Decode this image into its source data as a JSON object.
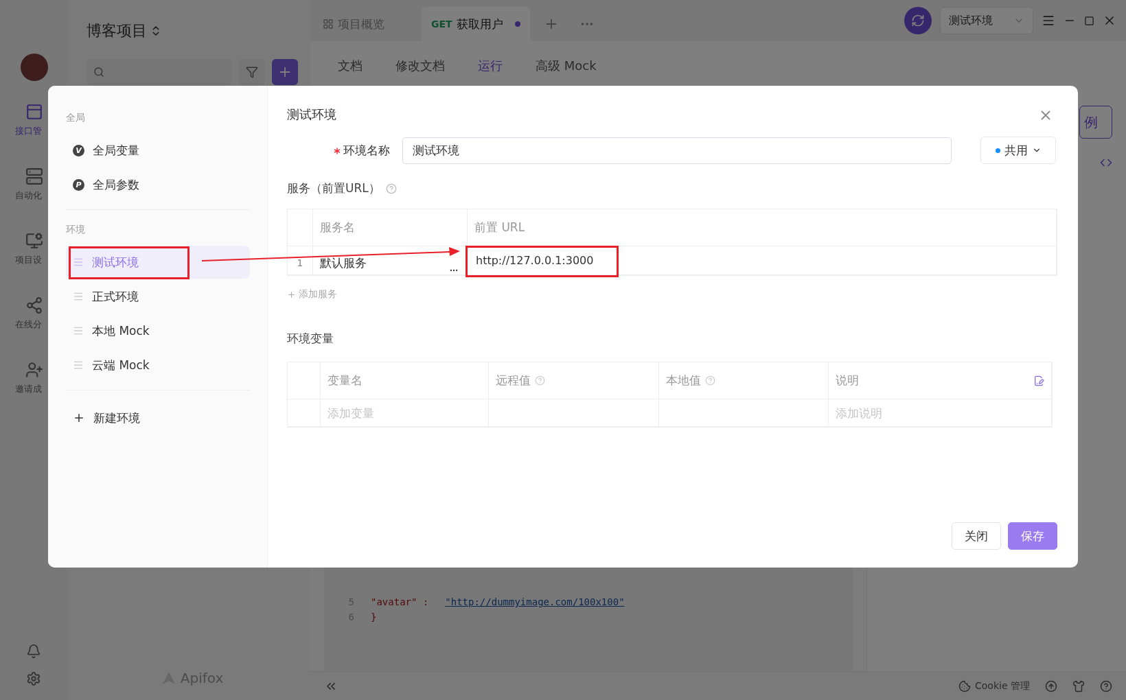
{
  "app": {
    "project_title": "博客项目",
    "rail": [
      {
        "label": "接口管",
        "selected": true
      },
      {
        "label": "自动化",
        "selected": false
      },
      {
        "label": "项目设",
        "selected": false
      },
      {
        "label": "在线分",
        "selected": false
      },
      {
        "label": "邀请成",
        "selected": false
      }
    ],
    "brand": "Apifox",
    "tabs": [
      {
        "label": "项目概览",
        "selected": false,
        "unsaved": false
      },
      {
        "method": "GET",
        "label": "获取用户",
        "selected": true,
        "unsaved": true
      }
    ],
    "env_selector": "测试环境",
    "nav": [
      {
        "label": "文档",
        "selected": false
      },
      {
        "label": "修改文档",
        "selected": false
      },
      {
        "label": "运行",
        "selected": true
      },
      {
        "label": "高级 Mock",
        "selected": false
      }
    ],
    "side_button": "例",
    "code_lines": [
      {
        "number": "5",
        "key": "\"avatar\" :",
        "value": "\"http://dummyimage.com/100x100\""
      },
      {
        "number": "6",
        "key": "}"
      }
    ],
    "status_bar": {
      "cookie": "Cookie 管理"
    }
  },
  "modal": {
    "sidebar": {
      "sections": [
        {
          "heading": "全局",
          "items": [
            {
              "kind": "global",
              "badge": "V",
              "label": "全局变量",
              "selected": false
            },
            {
              "kind": "global",
              "badge": "P",
              "label": "全局参数",
              "selected": false
            }
          ]
        },
        {
          "heading": "环境",
          "items": [
            {
              "kind": "env",
              "label": "测试环境",
              "selected": true
            },
            {
              "kind": "env",
              "label": "正式环境",
              "selected": false
            },
            {
              "kind": "env",
              "label": "本地 Mock",
              "selected": false
            },
            {
              "kind": "env",
              "label": "云端 Mock",
              "selected": false
            }
          ]
        }
      ],
      "new_label": "新建环境"
    },
    "title": "测试环境",
    "name_field": {
      "label": "环境名称",
      "required": true,
      "value": "测试环境"
    },
    "scope": {
      "label": "共用"
    },
    "services": {
      "heading": "服务（前置URL）",
      "columns": [
        "服务名",
        "前置 URL"
      ],
      "rows": [
        {
          "index": "1",
          "name": "默认服务",
          "url": "http://127.0.0.1:3000"
        }
      ],
      "add_label": "添加服务"
    },
    "variables": {
      "heading": "环境变量",
      "columns": [
        {
          "label": "变量名",
          "help": false
        },
        {
          "label": "远程值",
          "help": true
        },
        {
          "label": "本地值",
          "help": true
        },
        {
          "label": "说明",
          "help": false
        }
      ],
      "name_placeholder": "添加变量",
      "description_placeholder": "添加说明"
    },
    "buttons": {
      "close": "关闭",
      "save": "保存"
    }
  }
}
